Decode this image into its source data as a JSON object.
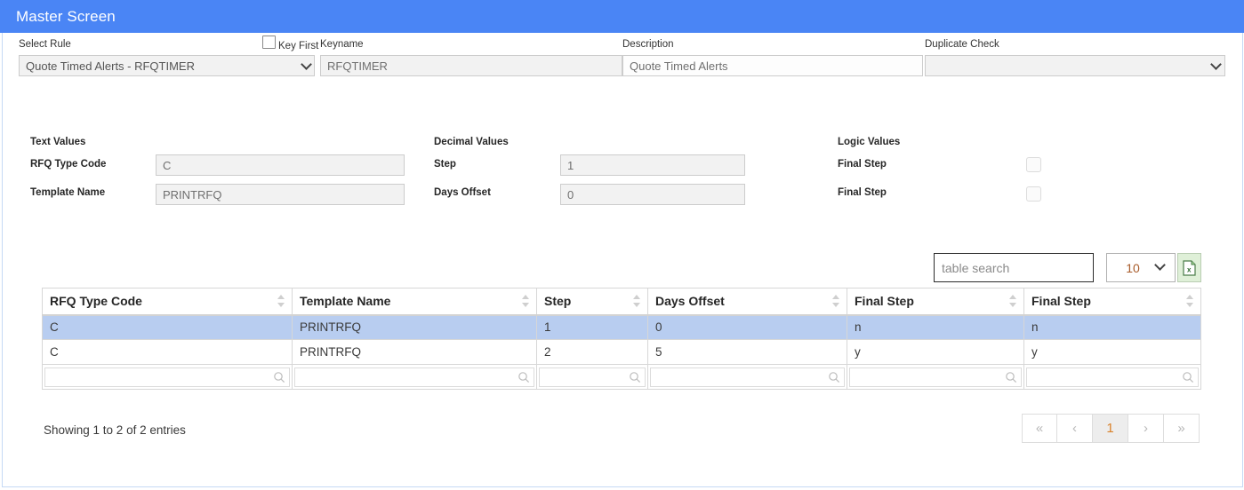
{
  "window": {
    "title": "Master Screen"
  },
  "header_form": {
    "select_rule": {
      "label": "Select Rule",
      "value": "Quote Timed Alerts - RFQTIMER"
    },
    "key_first": {
      "label": "Key First",
      "checked": false
    },
    "keyname": {
      "label": "Keyname",
      "value": "RFQTIMER"
    },
    "description": {
      "label": "Description",
      "value": "Quote Timed Alerts"
    },
    "duplicate_check": {
      "label": "Duplicate Check",
      "value": ""
    }
  },
  "groups": {
    "text_values": {
      "title": "Text Values",
      "fields": [
        {
          "label": "RFQ Type Code",
          "value": "C"
        },
        {
          "label": "Template Name",
          "value": "PRINTRFQ"
        }
      ]
    },
    "decimal_values": {
      "title": "Decimal Values",
      "fields": [
        {
          "label": "Step",
          "value": "1"
        },
        {
          "label": "Days Offset",
          "value": "0"
        }
      ]
    },
    "logic_values": {
      "title": "Logic Values",
      "fields": [
        {
          "label": "Final Step",
          "checked": false
        },
        {
          "label": "Final Step",
          "checked": false
        }
      ]
    }
  },
  "table_tools": {
    "search_placeholder": "table search",
    "search_value": "",
    "page_size": "10",
    "export_icon": "excel-export-icon"
  },
  "table": {
    "columns": [
      "RFQ Type Code",
      "Template Name",
      "Step",
      "Days Offset",
      "Final Step",
      "Final Step"
    ],
    "rows": [
      {
        "selected": true,
        "cells": [
          "C",
          "PRINTRFQ",
          "1",
          "0",
          "n",
          "n"
        ]
      },
      {
        "selected": false,
        "cells": [
          "C",
          "PRINTRFQ",
          "2",
          "5",
          "y",
          "y"
        ]
      }
    ],
    "filters": [
      "",
      "",
      "",
      "",
      "",
      ""
    ]
  },
  "footer": {
    "showing": "Showing 1 to 2 of 2 entries",
    "pager": [
      {
        "name": "first",
        "label": "«",
        "active": false
      },
      {
        "name": "prev",
        "label": "‹",
        "active": false
      },
      {
        "name": "page-1",
        "label": "1",
        "active": true
      },
      {
        "name": "next",
        "label": "›",
        "active": false
      },
      {
        "name": "last",
        "label": "»",
        "active": false
      }
    ]
  },
  "colors": {
    "titlebar": "#4a85f5",
    "selected_row": "#b8cdf0",
    "export_bg": "#dff0d8",
    "panel_border": "#c5d9f5"
  }
}
